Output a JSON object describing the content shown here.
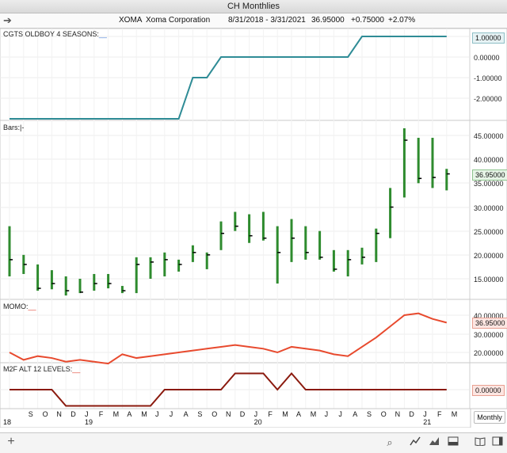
{
  "window_title": "CH Monthlies",
  "header": {
    "symbol": "XOMA",
    "name": "Xoma Corporation",
    "date_range": "8/31/2018 - 3/31/2021",
    "price": "36.95000",
    "change": "+0.75000",
    "change_pct": "+2.07%"
  },
  "panes": {
    "seasons": {
      "label": "CGTS OLDBOY 4 SEASONS:",
      "blank": "__",
      "ticks": [
        "0.00000",
        "-1.00000",
        "-2.00000"
      ],
      "current_value": "1.00000"
    },
    "bars": {
      "label": "Bars:",
      "blank": "|-",
      "ticks": [
        "45.00000",
        "40.00000",
        "35.00000",
        "30.00000",
        "25.00000",
        "20.00000",
        "15.00000"
      ],
      "current_value": "36.95000"
    },
    "momo": {
      "label": "MOMO:",
      "blank": "__",
      "ticks": [
        "40.00000",
        "30.00000",
        "20.00000"
      ],
      "current_value": "36.95000"
    },
    "m2f": {
      "label": "M2F ALT 12 LEVELS:",
      "blank": "__",
      "current_value": "0.00000"
    }
  },
  "x_axis": {
    "months": [
      "S",
      "O",
      "N",
      "D",
      "J",
      "F",
      "M",
      "A",
      "M",
      "J",
      "J",
      "A",
      "S",
      "O",
      "N",
      "D",
      "J",
      "F",
      "M",
      "A",
      "M",
      "J",
      "J",
      "A",
      "S",
      "O",
      "N",
      "D",
      "J",
      "F",
      "M"
    ],
    "years": [
      "18",
      "19",
      "20",
      "21"
    ]
  },
  "period_button": "Monthly",
  "colors": {
    "seasons_line": "#2f8c96",
    "bar_up": "#2e8b2e",
    "momo_line": "#e84a2e",
    "m2f_line": "#8b1a0e",
    "bars_value_bg": "#e6f4e6",
    "momo_value_bg": "#fde6e2",
    "seasons_value_bg": "#e6f2f4"
  },
  "bottom_icons": [
    "plus-icon",
    "search-icon",
    "line-chart-icon",
    "fill-chart-icon",
    "panel-icon",
    "book-icon",
    "sidebar-icon"
  ],
  "chart_data": {
    "type": "line",
    "x": [
      "2018-08",
      "2018-09",
      "2018-10",
      "2018-11",
      "2018-12",
      "2019-01",
      "2019-02",
      "2019-03",
      "2019-04",
      "2019-05",
      "2019-06",
      "2019-07",
      "2019-08",
      "2019-09",
      "2019-10",
      "2019-11",
      "2019-12",
      "2020-01",
      "2020-02",
      "2020-03",
      "2020-04",
      "2020-05",
      "2020-06",
      "2020-07",
      "2020-08",
      "2020-09",
      "2020-10",
      "2020-11",
      "2020-12",
      "2021-01",
      "2021-02",
      "2021-03"
    ],
    "series": [
      {
        "name": "CGTS OLDBOY 4 SEASONS",
        "values": [
          -3,
          -3,
          -3,
          -3,
          -3,
          -3,
          -3,
          -3,
          -3,
          -3,
          -3,
          -3,
          -3,
          -1,
          -1,
          0,
          0,
          0,
          0,
          0,
          0,
          0,
          0,
          0,
          0,
          1,
          1,
          1,
          1,
          1,
          1,
          1
        ]
      },
      {
        "name": "MOMO",
        "values": [
          20,
          16,
          18,
          17,
          15,
          16,
          15,
          14,
          19,
          17,
          18,
          19,
          20,
          21,
          22,
          23,
          24,
          23,
          22,
          20,
          23,
          22,
          21,
          19,
          18,
          23,
          28,
          34,
          40,
          41,
          38,
          36
        ]
      },
      {
        "name": "M2F ALT 12 LEVELS",
        "values": [
          0,
          0,
          0,
          0,
          -1,
          -1,
          -1,
          -1,
          -1,
          -1,
          -1,
          0,
          0,
          0,
          0,
          0,
          1,
          1,
          1,
          0,
          1,
          0,
          0,
          0,
          0,
          0,
          0,
          0,
          0,
          0,
          0,
          0
        ]
      }
    ],
    "ohlc": [
      {
        "x": "2018-08",
        "high": 26,
        "low": 15.5,
        "close": 19
      },
      {
        "x": "2018-09",
        "high": 20,
        "low": 16,
        "close": 18
      },
      {
        "x": "2018-10",
        "high": 18,
        "low": 12.5,
        "close": 13
      },
      {
        "x": "2018-11",
        "high": 16.8,
        "low": 12.8,
        "close": 14
      },
      {
        "x": "2018-12",
        "high": 15.5,
        "low": 11.5,
        "close": 12.5
      },
      {
        "x": "2019-01",
        "high": 15,
        "low": 12,
        "close": 12.2
      },
      {
        "x": "2019-02",
        "high": 16,
        "low": 12.5,
        "close": 14
      },
      {
        "x": "2019-03",
        "high": 16,
        "low": 13,
        "close": 14
      },
      {
        "x": "2019-04",
        "high": 13.5,
        "low": 12,
        "close": 12.5
      },
      {
        "x": "2019-05",
        "high": 19.5,
        "low": 12,
        "close": 18
      },
      {
        "x": "2019-06",
        "high": 19.5,
        "low": 15,
        "close": 18.5
      },
      {
        "x": "2019-07",
        "high": 20.5,
        "low": 15.5,
        "close": 19
      },
      {
        "x": "2019-08",
        "high": 19,
        "low": 16.5,
        "close": 18
      },
      {
        "x": "2019-09",
        "high": 22,
        "low": 18.5,
        "close": 20.5
      },
      {
        "x": "2019-10",
        "high": 20.5,
        "low": 17,
        "close": 20
      },
      {
        "x": "2019-11",
        "high": 27,
        "low": 21,
        "close": 24.5
      },
      {
        "x": "2019-12",
        "high": 29,
        "low": 25,
        "close": 26
      },
      {
        "x": "2019-01b",
        "high": 28.5,
        "low": 22.5,
        "close": 24
      },
      {
        "x": "2020-02",
        "high": 29,
        "low": 23,
        "close": 23.5
      },
      {
        "x": "2020-03",
        "high": 26,
        "low": 14,
        "close": 20.5
      },
      {
        "x": "2020-04",
        "high": 27.5,
        "low": 18.5,
        "close": 23.5
      },
      {
        "x": "2020-05",
        "high": 26,
        "low": 19,
        "close": 20.5
      },
      {
        "x": "2020-06",
        "high": 25,
        "low": 19,
        "close": 19.5
      },
      {
        "x": "2020-07",
        "high": 21,
        "low": 16.5,
        "close": 17
      },
      {
        "x": "2020-08",
        "high": 21,
        "low": 15.5,
        "close": 19
      },
      {
        "x": "2020-09",
        "high": 21.5,
        "low": 18,
        "close": 19.5
      },
      {
        "x": "2020-10",
        "high": 25.5,
        "low": 18.5,
        "close": 24.5
      },
      {
        "x": "2020-11",
        "high": 34,
        "low": 23.5,
        "close": 30
      },
      {
        "x": "2020-12",
        "high": 46.5,
        "low": 32,
        "close": 44
      },
      {
        "x": "2021-01",
        "high": 44.5,
        "low": 35,
        "close": 36
      },
      {
        "x": "2021-02",
        "high": 44.5,
        "low": 34,
        "close": 36.2
      },
      {
        "x": "2021-03",
        "high": 38,
        "low": 33.5,
        "close": 36.95
      }
    ]
  }
}
